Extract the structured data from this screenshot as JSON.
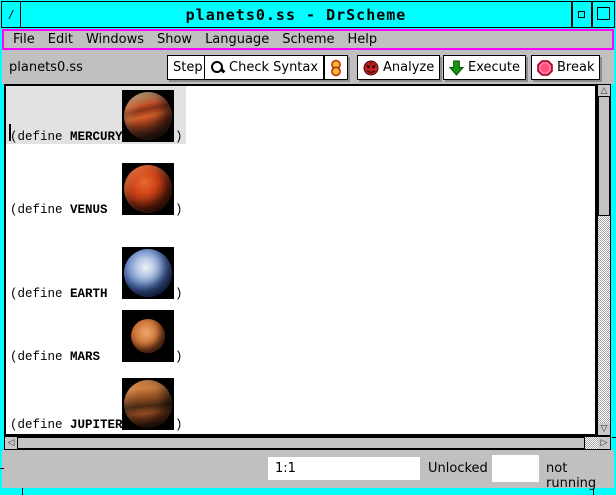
{
  "window": {
    "title": "planets0.ss - DrScheme",
    "menu_button_glyph": "/"
  },
  "menubar": {
    "items": [
      "File",
      "Edit",
      "Windows",
      "Show",
      "Language",
      "Scheme",
      "Help"
    ]
  },
  "toolbar": {
    "filename": "planets0.ss",
    "step_label": "Step",
    "check_syntax_label": "Check Syntax",
    "analyze_label": "Analyze",
    "execute_label": "Execute",
    "break_label": "Break"
  },
  "editor": {
    "definitions": [
      {
        "prefix": "(define ",
        "name": "MERCURY",
        "close": ")",
        "planet": "banded orange-brown planet image"
      },
      {
        "prefix": "(define ",
        "name": "VENUS",
        "close": ")",
        "planet": "mottled red-orange planet image"
      },
      {
        "prefix": "(define ",
        "name": "EARTH",
        "close": ")",
        "planet": "blue and white planet image"
      },
      {
        "prefix": "(define ",
        "name": "MARS",
        "close": ")",
        "planet": "small orange planet image"
      },
      {
        "prefix": "(define ",
        "name": "JUPITER",
        "close": ")",
        "planet": "orange-brown planet image (clipped at bottom edge)"
      }
    ]
  },
  "statusbar": {
    "caret_position": "1:1",
    "lock_status": "Unlocked",
    "run_status": "not running"
  },
  "colors": {
    "titlebar_cyan": "#00ffff",
    "menubar_highlight_magenta": "#ff00ff",
    "chrome_gray": "#c0c0c0",
    "first_line_highlight": "#e2e2e2"
  }
}
